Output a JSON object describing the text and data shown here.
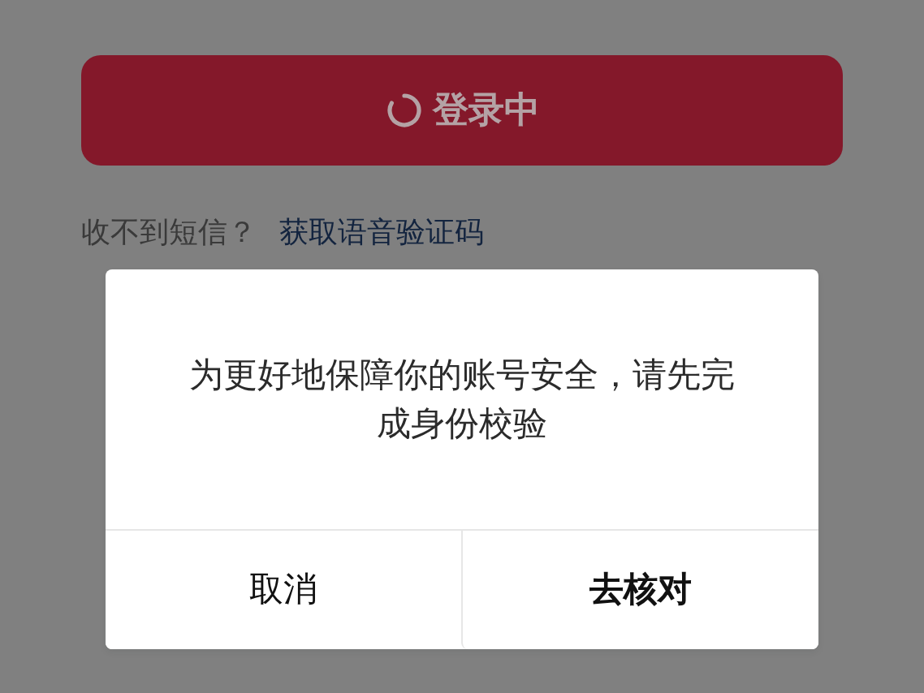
{
  "login_button": {
    "label": "登录中",
    "loading": true
  },
  "sms_help": {
    "text": "收不到短信？",
    "link": "获取语音验证码"
  },
  "dialog": {
    "message": "为更好地保障你的账号安全，请先完成身份校验",
    "buttons": [
      {
        "label": "取消",
        "kind": "secondary"
      },
      {
        "label": "去核对",
        "kind": "primary"
      }
    ]
  }
}
